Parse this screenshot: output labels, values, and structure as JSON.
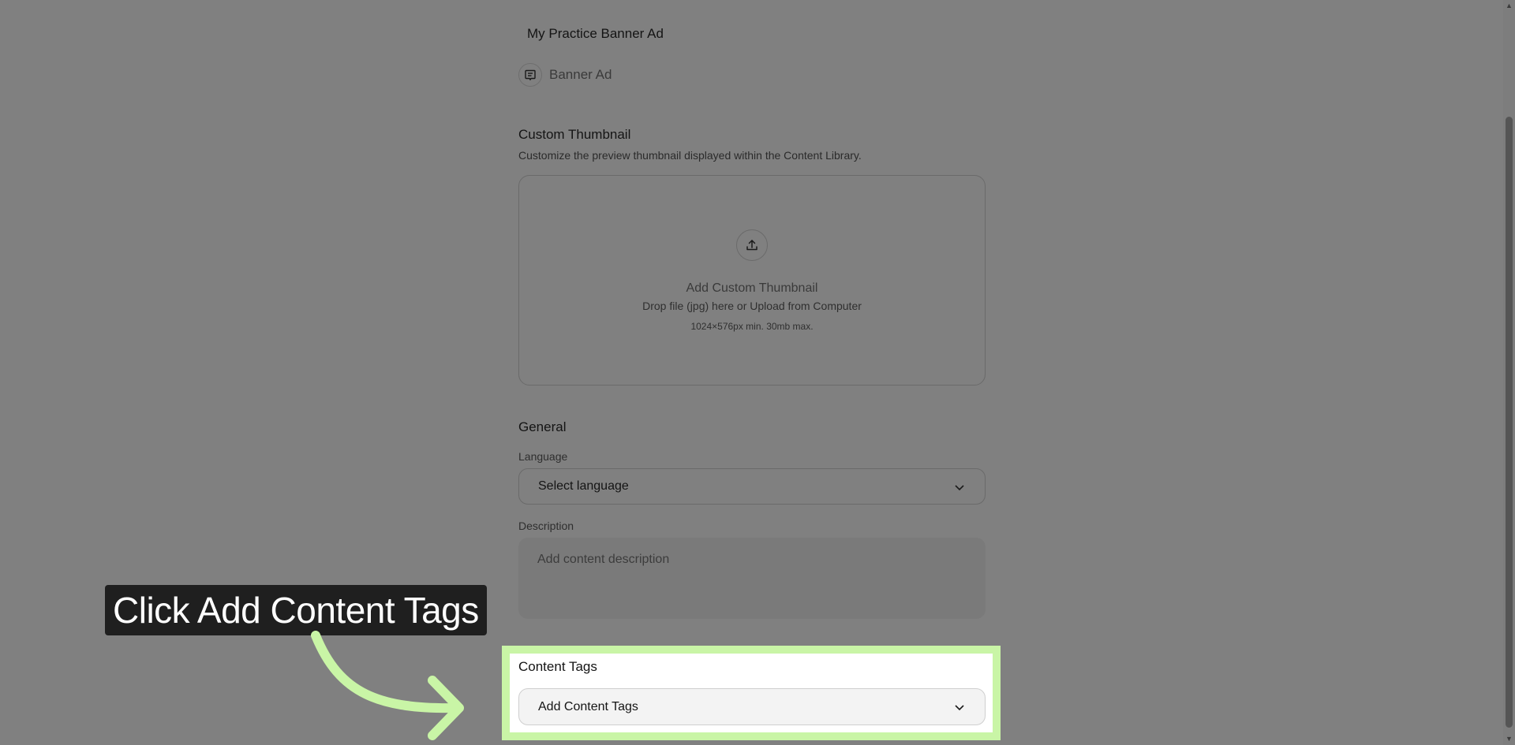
{
  "content": {
    "name": "My Practice Banner Ad",
    "type_label": "Banner Ad",
    "type_icon": "message-square-icon"
  },
  "thumbnail": {
    "title": "Custom Thumbnail",
    "description": "Customize the preview thumbnail displayed within the Content Library.",
    "dropzone_title": "Add Custom Thumbnail",
    "dropzone_subtitle": "Drop file (jpg) here or Upload from Computer",
    "dropzone_limits": "1024×576px min. 30mb max.",
    "upload_icon": "upload-icon"
  },
  "general": {
    "title": "General",
    "language_label": "Language",
    "language_value": "Select language",
    "description_label": "Description",
    "description_placeholder": "Add content description"
  },
  "content_tags": {
    "title": "Content Tags",
    "select_value": "Add Content Tags"
  },
  "tutorial": {
    "callout_text": "Click Add Content Tags",
    "highlight_color": "#c9f5a6"
  }
}
